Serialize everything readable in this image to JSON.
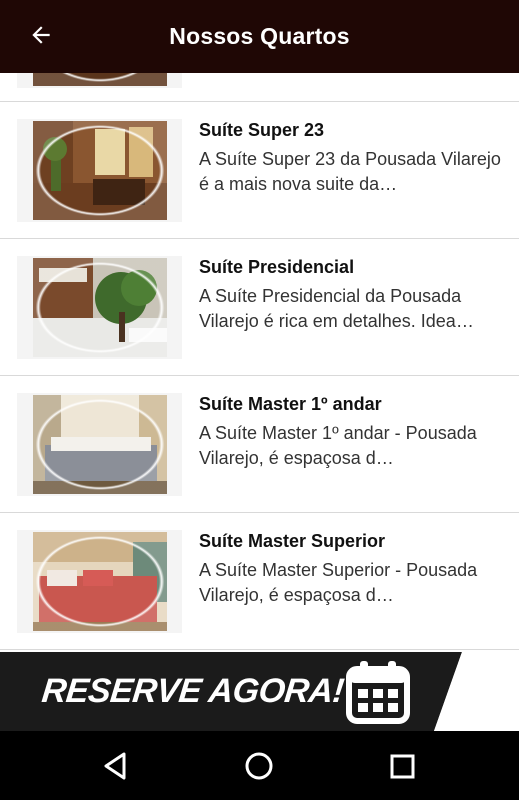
{
  "header": {
    "title": "Nossos Quartos",
    "back_icon": "arrow-left-icon"
  },
  "rooms": [
    {
      "title": "Suíte Super 23",
      "description": "A Suíte Super 23 da Pousada Vilarejo é a mais nova suite da…"
    },
    {
      "title": "Suíte Presidencial",
      "description": "A Suíte Presidencial da Pousada Vilarejo é rica em detalhes. Idea…"
    },
    {
      "title": "Suíte Master 1º andar",
      "description": "A Suíte Master 1º andar - Pousada Vilarejo, é espaçosa d…"
    },
    {
      "title": "Suíte Master Superior",
      "description": "A Suíte Master Superior - Pousada Vilarejo, é espaçosa d…"
    }
  ],
  "banner": {
    "text": "RESERVE AGORA!",
    "icon": "calendar-icon"
  },
  "system_nav": {
    "back": "nav-back-icon",
    "home": "nav-home-icon",
    "recents": "nav-recents-icon"
  },
  "colors": {
    "appbar": "#1f0705",
    "banner": "#1b1b1b",
    "navbar": "#000000"
  }
}
